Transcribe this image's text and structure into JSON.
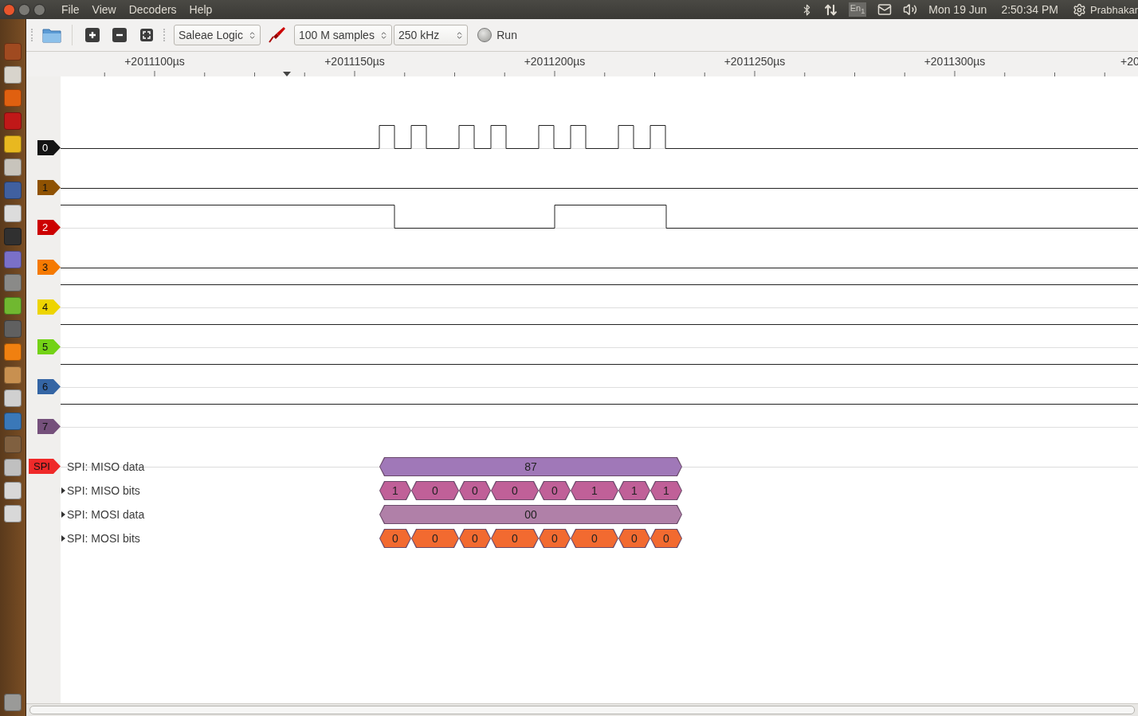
{
  "menu": [
    "File",
    "View",
    "Decoders",
    "Help"
  ],
  "indicators": {
    "keyboard": "En$_{1}$",
    "date": "Mon 19 Jun",
    "time": "2:50:34 PM",
    "user": "Prabhakar"
  },
  "toolbar": {
    "device": "Saleae Logic",
    "samples": "100 M samples",
    "rate": "250 kHz",
    "run": "Run"
  },
  "ruler": {
    "labels": [
      "+2011100µs",
      "+2011150µs",
      "+2011200µs",
      "+2011250µs",
      "+2011300µs",
      "+20"
    ]
  },
  "channels": [
    {
      "label": "0",
      "color": "#141414"
    },
    {
      "label": "1",
      "color": "#8f5202"
    },
    {
      "label": "2",
      "color": "#cc0000"
    },
    {
      "label": "3",
      "color": "#f57900"
    },
    {
      "label": "4",
      "color": "#edd400"
    },
    {
      "label": "5",
      "color": "#73d216"
    },
    {
      "label": "6",
      "color": "#3465a4"
    },
    {
      "label": "7",
      "color": "#75507b"
    }
  ],
  "decoder": {
    "tag": "SPI",
    "color": "#ef2929",
    "rows": [
      {
        "label": "SPI: MISO data",
        "color": "#a078b8",
        "annotations": [
          "87"
        ]
      },
      {
        "label": "SPI: MISO bits",
        "color": "#c06098",
        "expanded": false,
        "annotations": [
          "1",
          "0",
          "0",
          "0",
          "0",
          "1",
          "1",
          "1"
        ]
      },
      {
        "label": "SPI: MOSI data",
        "color": "#b080a8",
        "expanded": false,
        "annotations": [
          "00"
        ]
      },
      {
        "label": "SPI: MOSI bits",
        "color": "#f26a30",
        "expanded": false,
        "annotations": [
          "0",
          "0",
          "0",
          "0",
          "0",
          "0",
          "0",
          "0"
        ]
      }
    ]
  }
}
